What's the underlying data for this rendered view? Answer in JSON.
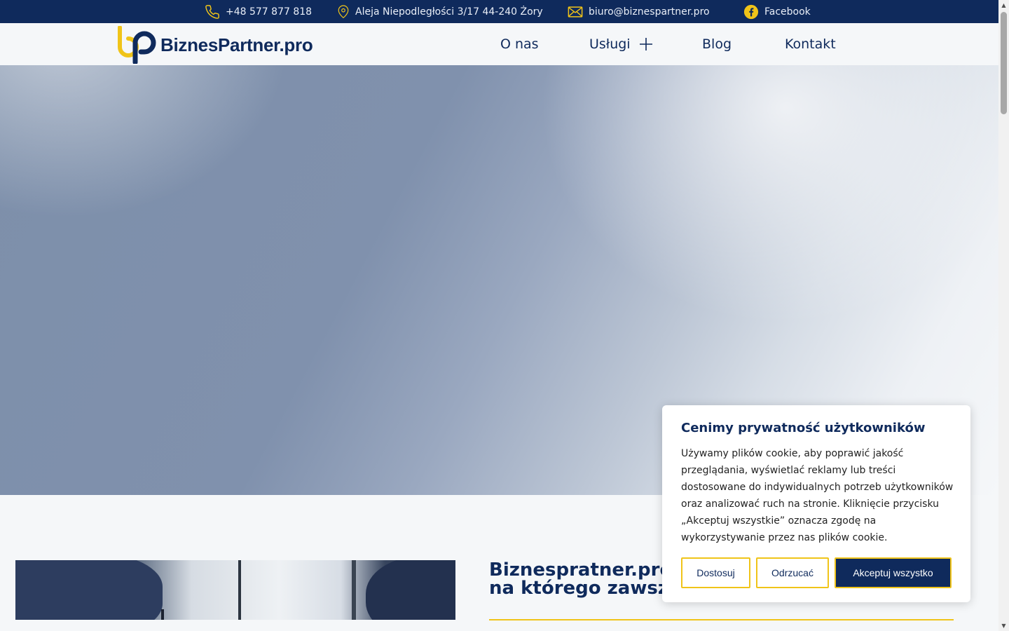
{
  "topbar": {
    "phone": "+48 577 877 818",
    "address": "Aleja Niepodległości 3/17 44-240 Żory",
    "email": "biuro@biznespartner.pro",
    "facebook": "Facebook"
  },
  "header": {
    "logo_text": "BiznesPartner.pro",
    "nav": {
      "about": "O nas",
      "services": "Usługi",
      "blog": "Blog",
      "contact": "Kontakt"
    }
  },
  "section": {
    "heading_line1": "Biznespratner.pro -",
    "heading_line2": "na którego zawsze"
  },
  "cookie": {
    "title": "Cenimy prywatność użytkowników",
    "text": "Używamy plików cookie, aby poprawić jakość przeglądania, wyświetlać reklamy lub treści dostosowane do indywidualnych potrzeb użytkowników oraz analizować ruch na stronie. Kliknięcie przycisku „Akceptuj wszystkie” oznacza zgodę na wykorzystywanie przez nas plików cookie.",
    "customize": "Dostosuj",
    "reject": "Odrzucać",
    "accept": "Akceptuj wszystko"
  },
  "colors": {
    "brand_navy": "#0f2a5c",
    "brand_yellow": "#f0c419",
    "page_bg": "#f5f7f9"
  },
  "icons": [
    "phone-icon",
    "map-pin-icon",
    "mail-icon",
    "facebook-icon",
    "plus-icon",
    "logo-mark"
  ]
}
